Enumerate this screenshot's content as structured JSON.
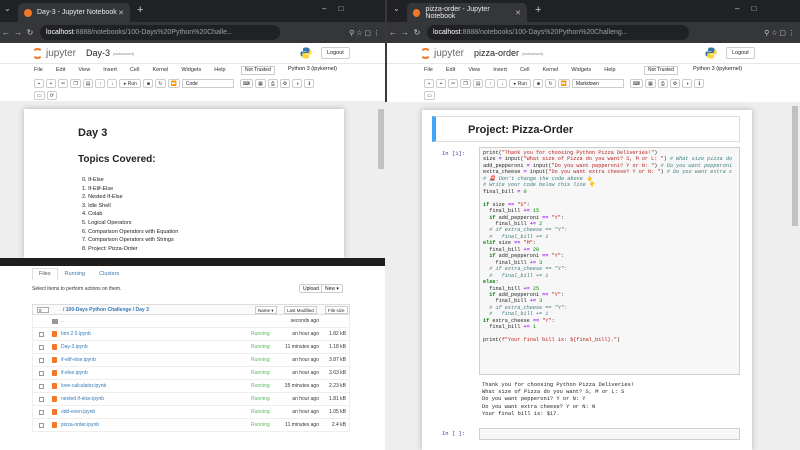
{
  "left": {
    "tab_title": "Day-3 - Jupyter Notebook",
    "url_host": "localhost",
    "url_path": ":8888/notebooks/100-Days%20Python%20Challe...",
    "notebook_name": "Day-3",
    "autosaved": "(autosaved)",
    "logout": "Logout",
    "menu": [
      "File",
      "Edit",
      "View",
      "Insert",
      "Cell",
      "Kernel",
      "Widgets",
      "Help"
    ],
    "not_trusted": "Not Trusted",
    "kernel": "Python 3 (ipykernel)",
    "run_label": "Run",
    "cell_type": "Code",
    "heading1": "Day 3",
    "heading2": "Topics Covered:",
    "topics": [
      "0. If-Else",
      "1. If-Elif-Else",
      "2. Nested If-Else",
      "3. Idle Shell",
      "4. Colab",
      "5. Logical Operators",
      "6. Comparison Operators with Equation",
      "7. Comparison Operators with Strings",
      "8. Project: Pizza-Order"
    ],
    "tree": {
      "tabs": [
        "Files",
        "Running",
        "Clusters"
      ],
      "hint": "Select items to perform actions on them.",
      "upload": "Upload",
      "new": "New ▾",
      "count": "0",
      "breadcrumb": "/ 100-Days Python Challenge / Day 3",
      "col_name": "Name ▾",
      "col_modified": "Last Modified",
      "col_size": "File size",
      "rows": [
        {
          "name": "..",
          "running": "",
          "modified": "seconds ago",
          "size": "",
          "kind": "folder"
        },
        {
          "name": "bmi 2.0.ipynb",
          "running": "Running",
          "modified": "an hour ago",
          "size": "1.82 kB",
          "kind": "nb"
        },
        {
          "name": "Day-3.ipynb",
          "running": "Running",
          "modified": "11 minutes ago",
          "size": "1.18 kB",
          "kind": "nb"
        },
        {
          "name": "if-elif-else.ipynb",
          "running": "Running",
          "modified": "an hour ago",
          "size": "3.87 kB",
          "kind": "nb"
        },
        {
          "name": "if-else.ipynb",
          "running": "Running",
          "modified": "an hour ago",
          "size": "3.63 kB",
          "kind": "nb"
        },
        {
          "name": "love-calculator.ipynb",
          "running": "Running",
          "modified": "35 minutes ago",
          "size": "2.23 kB",
          "kind": "nb"
        },
        {
          "name": "nested if-else.ipynb",
          "running": "Running",
          "modified": "an hour ago",
          "size": "1.81 kB",
          "kind": "nb"
        },
        {
          "name": "odd-even.ipynb",
          "running": "Running",
          "modified": "an hour ago",
          "size": "1.05 kB",
          "kind": "nb"
        },
        {
          "name": "pizza-order.ipynb",
          "running": "Running",
          "modified": "11 minutes ago",
          "size": "2.4 kB",
          "kind": "nb"
        }
      ]
    }
  },
  "right": {
    "tab_title": "pizza-order - Jupyter Notebook",
    "url_host": "localhost",
    "url_path": ":8888/notebooks/100-Days%20Python%20Challeng...",
    "notebook_name": "pizza-order",
    "autosaved": "(autosaved)",
    "logout": "Logout",
    "menu": [
      "File",
      "Edit",
      "View",
      "Insert",
      "Cell",
      "Kernel",
      "Widgets",
      "Help"
    ],
    "not_trusted": "Not Trusted",
    "kernel": "Python 3 (ipykernel)",
    "run_label": "Run",
    "cell_type": "Markdown",
    "md_title": "Project: Pizza-Order",
    "in_prompt": "In [1]:",
    "in_prompt_empty": "In [ ]:",
    "output": [
      "Thank you for choosing Python Pizza Deliveries!",
      "What size of Pizza do you want? S, M or L: S",
      "Do you want pepperoni? Y or N: Y",
      "Do you want extra cheese? Y or N: N",
      "Your final bill is: $17."
    ]
  }
}
